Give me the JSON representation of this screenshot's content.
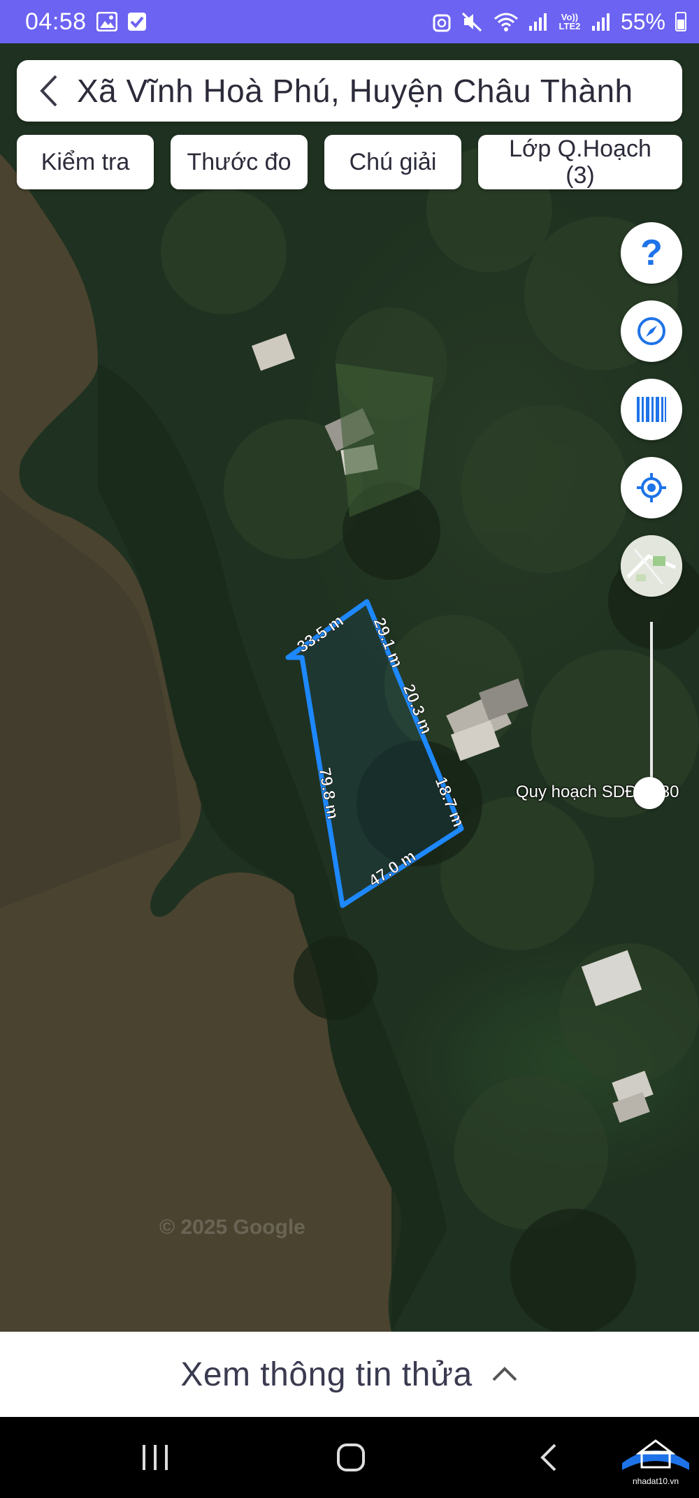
{
  "status_bar": {
    "time": "04:58",
    "network": "Vo)) LTE2",
    "battery": "55%"
  },
  "header": {
    "location": "Xã Vĩnh Hoà Phú, Huyện Châu Thành"
  },
  "toolbar": {
    "check_label": "Kiểm tra",
    "measure_label": "Thước đo",
    "legend_label": "Chú giải",
    "layers_label": "Lớp Q.Hoạch\n(3)"
  },
  "map": {
    "parcel_outline_color": "#1e88ff",
    "edge_labels": [
      "33.5 m",
      "29.1 m",
      "20.3 m",
      "18.7 m",
      "47.0 m",
      "79.8 m"
    ],
    "planning_slider_label": "Quy hoạch SDĐ 2030",
    "attribution": "© 2025 Google"
  },
  "controls": {
    "help_glyph": "?",
    "icons": [
      "help-icon",
      "compass-icon",
      "barcode-icon",
      "locate-icon",
      "minimap-icon"
    ]
  },
  "bottom_sheet": {
    "label": "Xem thông tin thửa"
  },
  "watermark_logo": "nhadat10.vn"
}
